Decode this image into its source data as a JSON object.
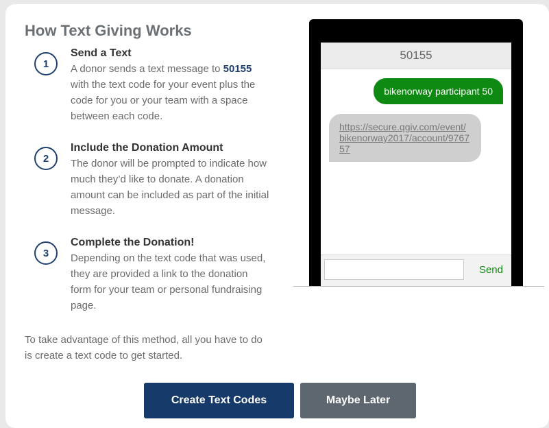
{
  "title": "How Text Giving Works",
  "steps": [
    {
      "number": "1",
      "title": "Send a Text",
      "body_before": "A donor sends a text message to ",
      "body_highlight": "50155",
      "body_after": " with the text code for your event plus the code for you or your team with a space between each code."
    },
    {
      "number": "2",
      "title": "Include the Donation Amount",
      "body": "The donor will be prompted to indicate how much they’d like to donate. A donation amount can be included as part of the initial message."
    },
    {
      "number": "3",
      "title": "Complete the Donation!",
      "body": "Depending on the text code that was used, they are provided a link to the donation form for your team or personal fundraising page."
    }
  ],
  "footer_note": "To take advantage of this method, all you have to do is create a text code to get started.",
  "phone": {
    "header": "50155",
    "outgoing_message": "bikenorway participant 50",
    "incoming_message": "https://secure.qgiv.com/event/bikenorway2017/account/976757",
    "send_label": "Send",
    "input_value": ""
  },
  "buttons": {
    "primary": "Create Text Codes",
    "secondary": "Maybe Later"
  },
  "colors": {
    "accent": "#163a69",
    "sms_green": "#0e8a12",
    "secondary_button": "#5e6770"
  }
}
